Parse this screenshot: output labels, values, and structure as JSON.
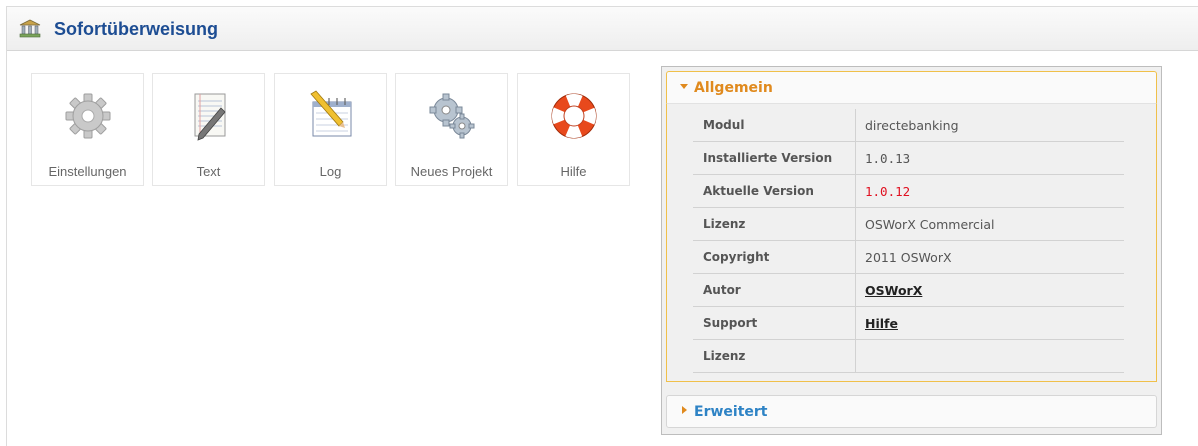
{
  "header": {
    "title": "Sofortüberweisung",
    "icon": "bank-building-icon"
  },
  "tiles": [
    {
      "label": "Einstellungen",
      "icon": "gear-icon"
    },
    {
      "label": "Text",
      "icon": "notepad-pen-icon"
    },
    {
      "label": "Log",
      "icon": "log-notebook-icon"
    },
    {
      "label": "Neues Projekt",
      "icon": "gears-icon"
    },
    {
      "label": "Hilfe",
      "icon": "lifebuoy-icon"
    }
  ],
  "panel": {
    "general_title": "Allgemein",
    "advanced_title": "Erweitert",
    "rows": [
      {
        "key": "Modul",
        "value": "directebanking"
      },
      {
        "key": "Installierte Version",
        "value": "1.0.13"
      },
      {
        "key": "Aktuelle Version",
        "value": "1.0.12"
      },
      {
        "key": "Lizenz",
        "value": "OSWorX Commercial"
      },
      {
        "key": "Copyright",
        "value": "2011 OSWorX"
      },
      {
        "key": "Autor",
        "value": "OSWorX"
      },
      {
        "key": "Support",
        "value": "Hilfe"
      },
      {
        "key": "Lizenz",
        "value": ""
      }
    ]
  },
  "colors": {
    "title_blue": "#1d4d93",
    "accent_orange": "#e08a1e",
    "advanced_blue": "#2e83c5",
    "version_red": "#e01020"
  }
}
